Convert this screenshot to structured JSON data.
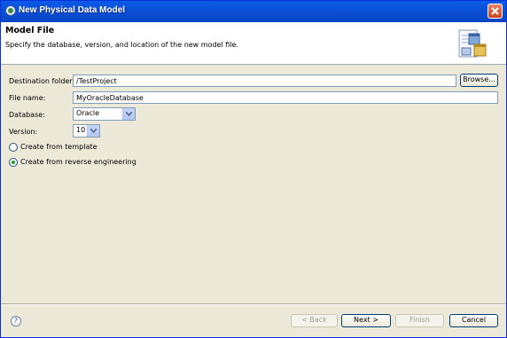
{
  "window": {
    "title": "New Physical Data Model"
  },
  "header": {
    "title": "Model File",
    "description": "Specify the database, version, and location of the new model file."
  },
  "form": {
    "destination_label": "Destination folder:",
    "destination_value": "/TestProject",
    "browse_label": "Browse...",
    "filename_label": "File name:",
    "filename_value": "MyOracleDatabase",
    "database_label": "Database:",
    "database_value": "Oracle",
    "version_label": "Version:",
    "version_value": "10",
    "radio_template": "Create from template",
    "radio_reverse": "Create from reverse engineering",
    "selected_option": "reverse"
  },
  "footer": {
    "back_label": "< Back",
    "next_label": "Next >",
    "finish_label": "Finish",
    "cancel_label": "Cancel",
    "help_glyph": "?"
  },
  "colors": {
    "titlebar": "#0a5be8",
    "dialog_bg": "#ece9d8",
    "radio_selected": "#21a121"
  }
}
